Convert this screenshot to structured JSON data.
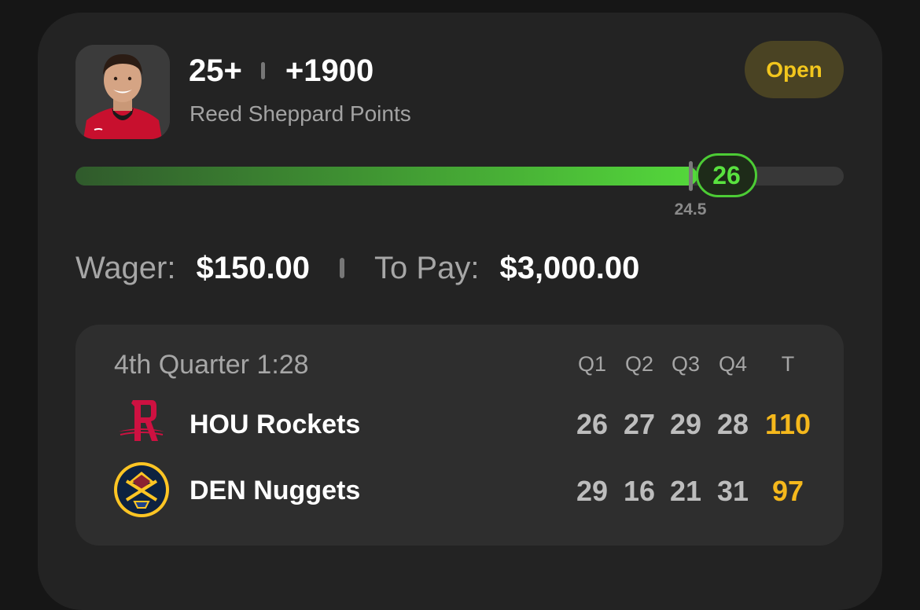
{
  "bet": {
    "line": "25+",
    "odds": "+1900",
    "market": "Reed Sheppard Points",
    "status": "Open"
  },
  "progress": {
    "current": 26,
    "threshold_label": "24.5",
    "fill_fraction": 0.81
  },
  "wager": {
    "wager_label": "Wager:",
    "wager_value": "$150.00",
    "payout_label": "To Pay:",
    "payout_value": "$3,000.00"
  },
  "game": {
    "status": "4th Quarter 1:28",
    "headers": [
      "Q1",
      "Q2",
      "Q3",
      "Q4",
      "T"
    ],
    "teams": [
      {
        "name": "HOU Rockets",
        "logo": "rockets-logo",
        "scores": [
          "26",
          "27",
          "29",
          "28"
        ],
        "total": "110"
      },
      {
        "name": "DEN Nuggets",
        "logo": "nuggets-logo",
        "scores": [
          "29",
          "16",
          "21",
          "31"
        ],
        "total": "97"
      }
    ]
  },
  "colors": {
    "accent_green": "#54d83b",
    "open_yellow": "#f2c61d",
    "total_gold": "#f5b81c"
  }
}
